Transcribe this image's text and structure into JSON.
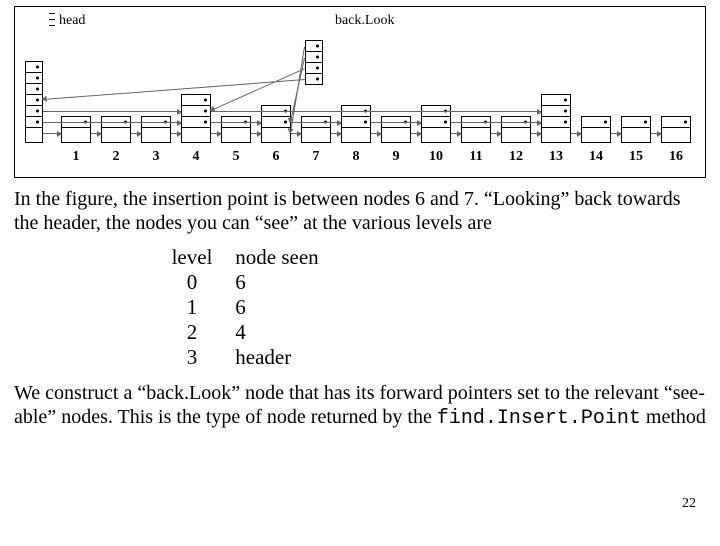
{
  "figure": {
    "label_head": "head",
    "label_backlook": "back.Look",
    "node_numbers": [
      "1",
      "2",
      "3",
      "4",
      "5",
      "6",
      "7",
      "8",
      "9",
      "10",
      "11",
      "12",
      "13",
      "14",
      "15",
      "16"
    ],
    "node_levels": [
      1,
      1,
      1,
      3,
      1,
      2,
      1,
      2,
      1,
      2,
      1,
      1,
      3,
      1,
      1,
      1
    ],
    "head_levels": 6,
    "backlook_levels": 4
  },
  "paragraph1": "In the figure, the insertion point is between nodes 6 and 7. “Looking” back towards the header, the nodes you can “see” at the various levels are",
  "table": {
    "header": {
      "level": "level",
      "seen": "node seen"
    },
    "rows": [
      {
        "level": "0",
        "seen": "6"
      },
      {
        "level": "1",
        "seen": "6"
      },
      {
        "level": "2",
        "seen": "4"
      },
      {
        "level": "3",
        "seen": "header"
      }
    ]
  },
  "paragraph2_a": "We construct a “back.Look” node that has its forward pointers set to the relevant “see-able” nodes.  This is the type of node returned by the ",
  "paragraph2_code": "find.Insert.Point",
  "paragraph2_b": " method",
  "page_number": "22"
}
